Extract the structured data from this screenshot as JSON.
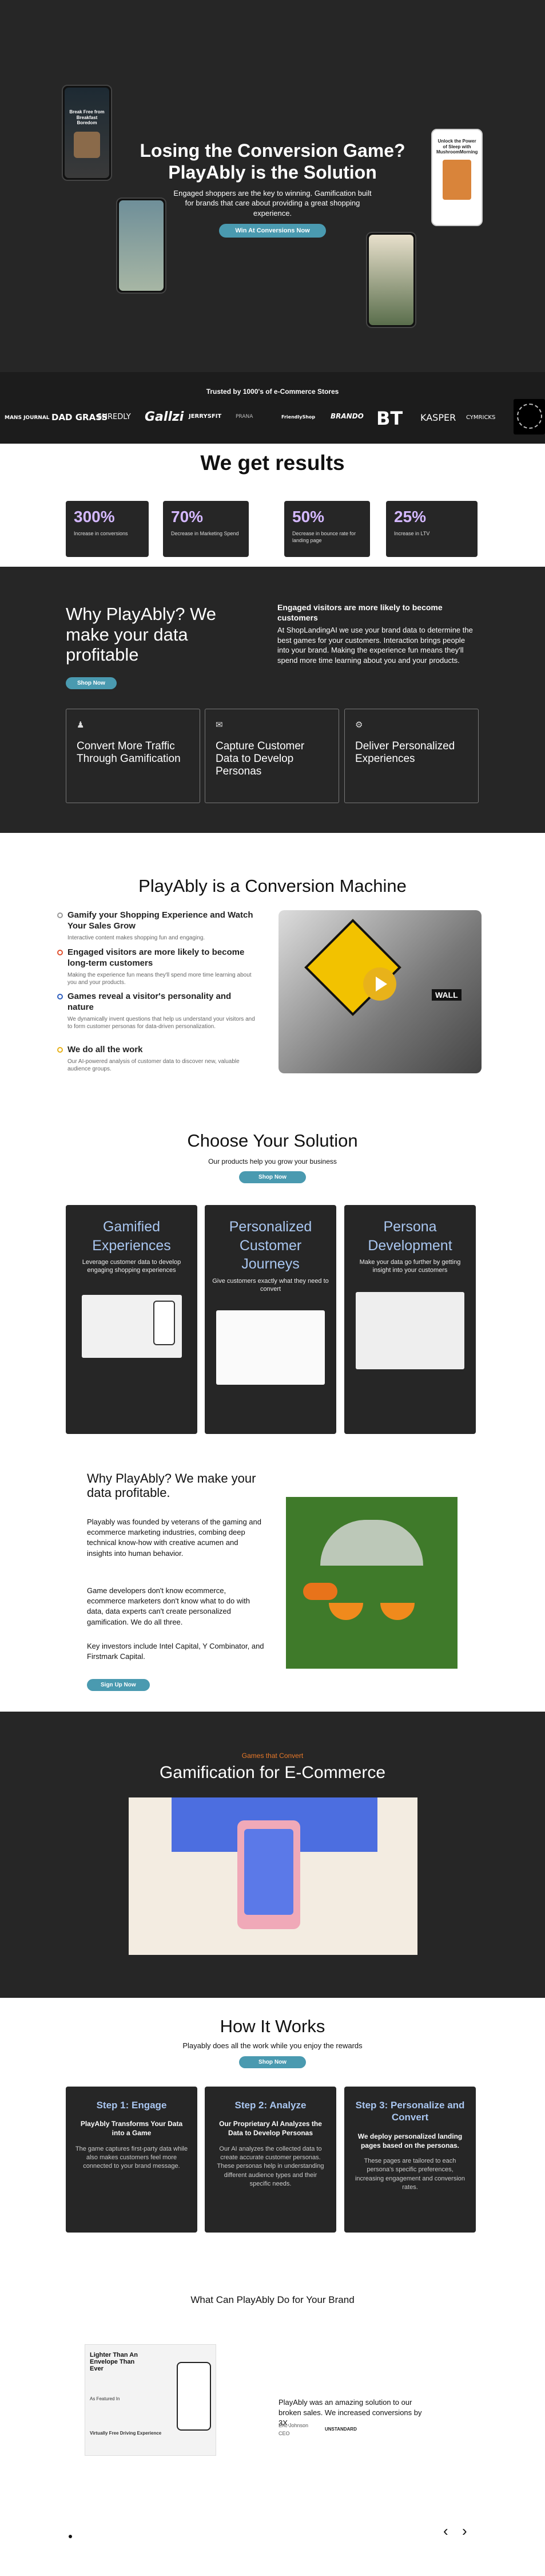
{
  "hero": {
    "title_line1": "Losing the Conversion Game?",
    "title_line2": "PlayAbly is the Solution",
    "subtitle": "Engaged shoppers are the key to winning.  Gamification built for brands that care about providing a great shopping experience.",
    "cta_label": "Win At Conversions Now",
    "phone_left_text": "Break Free from Breakfast Boredom",
    "phone_right_text": "Unlock the Power of Sleep with MushroomMorning"
  },
  "logos": {
    "heading": "Trusted by 1000's of e-Commerce Stores",
    "items": [
      "MANS JOURNAL",
      "DAD GRASS",
      "SHREDLY",
      "Gallzi",
      "JERRYSFIT",
      "PRANA",
      "FriendlyShop",
      "BRANDO",
      "BT",
      "KASPER",
      "CYMRICKS",
      ""
    ]
  },
  "results": {
    "heading": "We get results",
    "stats": [
      {
        "value": "300%",
        "label": "Increase in conversions"
      },
      {
        "value": "70%",
        "label": "Decrease in Marketing Spend"
      },
      {
        "value": "50%",
        "label": "Decrease in bounce rate for landing page"
      },
      {
        "value": "25%",
        "label": "Increase in LTV"
      }
    ]
  },
  "why": {
    "heading": "Why PlayAbly? We make your data profitable",
    "cta_label": "Shop Now",
    "right_heading": "Engaged visitors are more likely to become customers",
    "right_body": "At ShopLandingAI we use your brand data to determine the best games for your customers. Interaction brings people into your brand.  Making the experience fun means they'll spend more time learning about you and your products.",
    "cards": [
      {
        "icon": "person-icon",
        "title": "Convert More Traffic Through Gamification"
      },
      {
        "icon": "mail-icon",
        "title": "Capture Customer Data to Develop Personas"
      },
      {
        "icon": "gear-icon",
        "title": "Deliver Personalized Experiences"
      }
    ]
  },
  "machine": {
    "heading": "PlayAbly is a Conversion Machine",
    "features": [
      {
        "title": "Gamify your Shopping Experience and Watch Your Sales Grow",
        "desc": "Interactive content makes shopping fun and engaging.",
        "color": "#999999"
      },
      {
        "title": "Engaged visitors are more likely to become long-term customers",
        "desc": "Making the experience fun means they'll spend more time learning about you and your products.",
        "color": "#e0502e"
      },
      {
        "title": "Games reveal a visitor's personality and nature",
        "desc": "We dynamically invent questions that help us understand your visitors and to form customer personas for data-driven personalization.",
        "color": "#2f5fbf"
      },
      {
        "title": "We do all the work",
        "desc": "Our AI-powered analysis of customer data to discover new, valuable audience groups.",
        "color": "#e8b21a"
      }
    ],
    "video_sign": "WALL"
  },
  "solution": {
    "heading": "Choose Your Solution",
    "subheading": "Our products help you grow your business",
    "cta_label": "Shop Now",
    "cards": [
      {
        "title": "Gamified Experiences",
        "desc": "Leverage customer data to develop engaging shopping experiences"
      },
      {
        "title": "Personalized Customer Journeys",
        "desc": "Give customers exactly what they need to convert"
      },
      {
        "title": "Persona Development",
        "desc": "Make your data go further by getting insight into your customers"
      }
    ]
  },
  "about": {
    "heading": "Why PlayAbly? We make your data profitable.",
    "p1": "Playably was founded by veterans of the gaming and ecommerce marketing industries, combing deep technical know-how with creative acumen and insights into human behavior.",
    "p2": "Game developers don't know ecommerce, ecommerce marketers don't know what to do with data, data experts can't create personalized gamification. We do all three.",
    "p3": "Key investors include Intel Capital, Y Combinator, and Firstmark Capital.",
    "cta_label": "Sign Up Now"
  },
  "ecom": {
    "eyebrow": "Games that Convert",
    "heading": "Gamification for E-Commerce"
  },
  "how": {
    "heading": "How It Works",
    "subheading": "Playably does all the work while you enjoy the rewards",
    "cta_label": "Shop Now",
    "steps": [
      {
        "title": "Step 1: Engage",
        "subtitle": "PlayAbly Transforms Your Data into a Game",
        "desc": "The game captures first-party data while also makes customers feel more connected to your brand message."
      },
      {
        "title": "Step 2: Analyze",
        "subtitle": "Our Proprietary AI Analyzes the Data to Develop Personas",
        "desc": "Our AI analyzes the collected data to create accurate customer personas. These personas help in understanding different audience types and their specific needs."
      },
      {
        "title": "Step 3: Personalize and Convert",
        "subtitle": "We deploy personalized landing pages based on the personas.",
        "desc": "These pages are tailored to each persona's specific preferences, increasing engagement and conversion rates."
      }
    ]
  },
  "testimonial": {
    "heading": "What Can PlayAbly Do for Your Brand",
    "quote": "PlayAbly was an amazing solution to our broken sales. We increased conversions by 3X.",
    "author": "Eric Johnson",
    "role": "CEO",
    "brand": "UNSTANDARD",
    "mock_headline": "Lighter Than An Envelope Than Ever",
    "mock_sub": "As Featured In",
    "mock_bottom": "Virtually Free Driving Experience"
  }
}
